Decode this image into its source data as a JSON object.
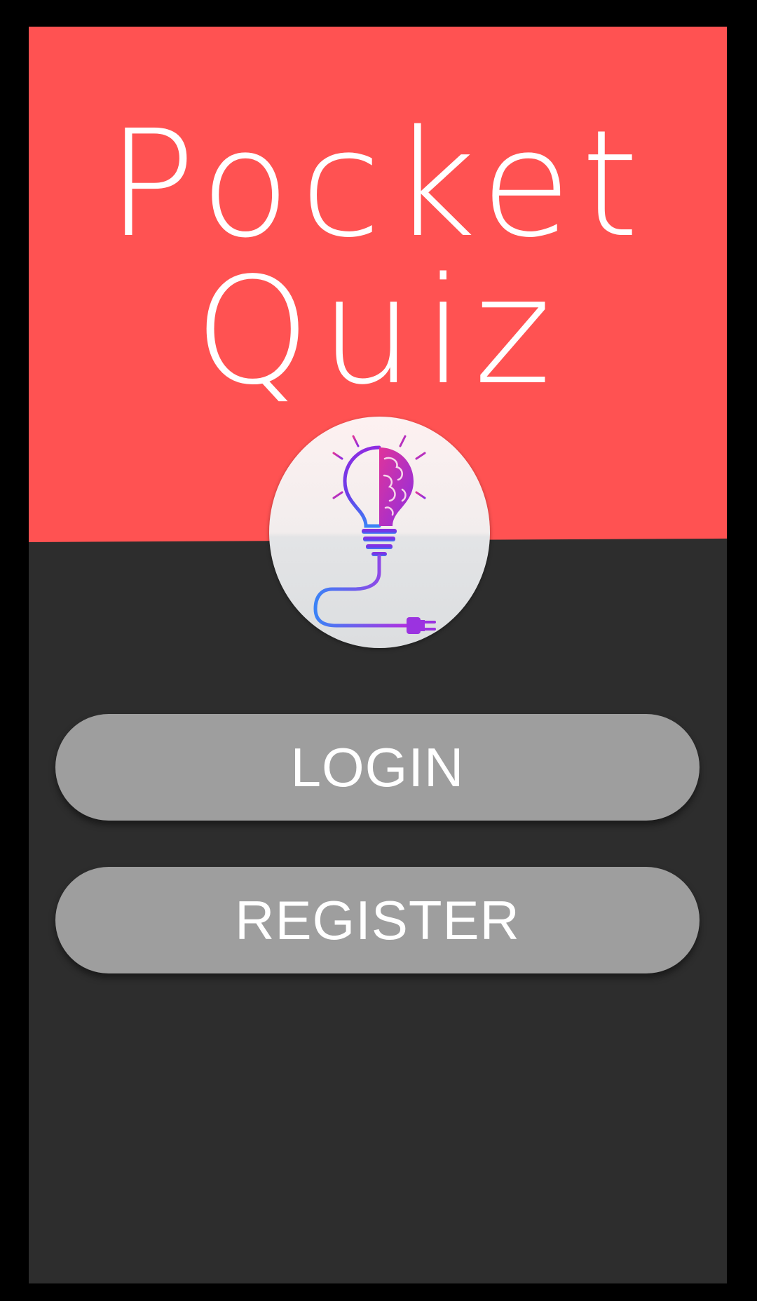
{
  "app": {
    "title_line1": "Pocket",
    "title_line2": "Quiz",
    "logo_icon": "lightbulb-brain-plug-icon"
  },
  "actions": {
    "login_label": "LOGIN",
    "register_label": "REGISTER"
  },
  "colors": {
    "hero_background": "#ff5252",
    "page_background": "#2d2d2d",
    "button_background": "#9e9e9e",
    "text": "#ffffff",
    "logo_gradient_start": "#ff2d9b",
    "logo_gradient_end": "#3b82f6"
  }
}
